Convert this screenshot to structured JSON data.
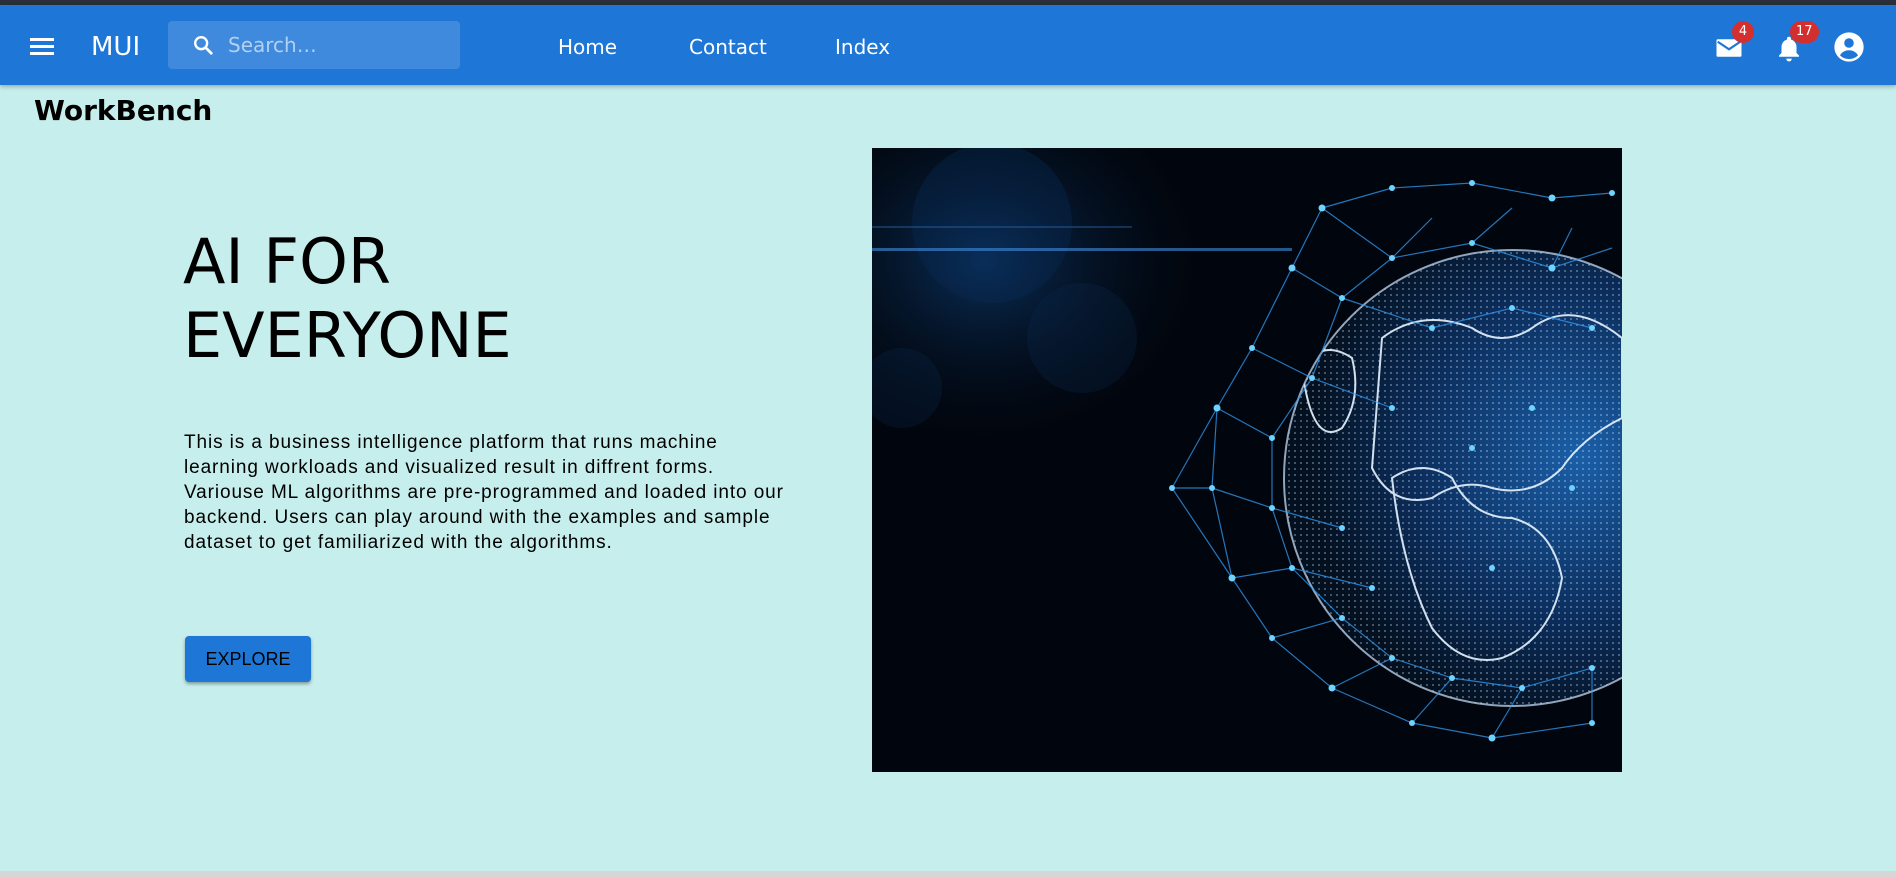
{
  "appbar": {
    "brand": "MUI",
    "search_placeholder": "Search…",
    "nav": [
      "Home",
      "Contact",
      "Index"
    ],
    "mail_count": "4",
    "notification_count": "17",
    "background_color": "#1e76d6"
  },
  "page": {
    "title": "WorkBench",
    "background_color": "#c6eeec"
  },
  "hero": {
    "heading_line1": "AI FOR",
    "heading_line2": "EVERYONE",
    "description": "This is a business intelligence platform that runs machine learning workloads and visualized result in diffrent forms. Variouse ML algorithms are pre-programmed and loaded into our backend. Users can play around with the examples and sample dataset to get familiarized with the algorithms.",
    "cta_label": "EXPLORE",
    "image_icon": "globe-network-image"
  }
}
